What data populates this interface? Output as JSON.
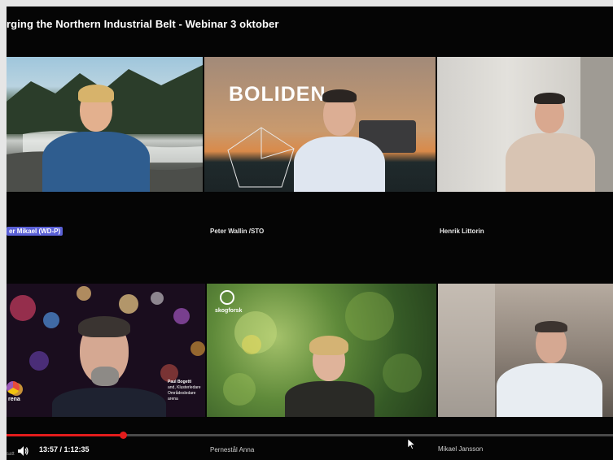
{
  "video": {
    "title": "rging the Northern Industrial Belt - Webinar 3 oktober",
    "time_display": "13:57 / 1:12:35",
    "progress": 0.192,
    "accent_color": "#e31c1c"
  },
  "participants": [
    {
      "name": "er Mikael (WD-P)",
      "highlighted": true
    },
    {
      "name": "Peter Wallin /STO"
    },
    {
      "name": "Henrik Littorin"
    },
    {
      "name": ""
    },
    {
      "name": "Pernestål Anna"
    },
    {
      "name": "Mikael Jansson"
    }
  ],
  "logos": {
    "boliden": "BOLIDEN",
    "skogforsk": "skogforsk",
    "arena": "rena"
  },
  "overlay_caption": {
    "name": "Paul Bogetti",
    "line1": "and, Klusterledare",
    "line2": "Områdesledare",
    "line3": "arena"
  },
  "partial_label": "satt",
  "icons": {
    "volume": "volume-icon",
    "cursor": "mouse-cursor-icon"
  }
}
